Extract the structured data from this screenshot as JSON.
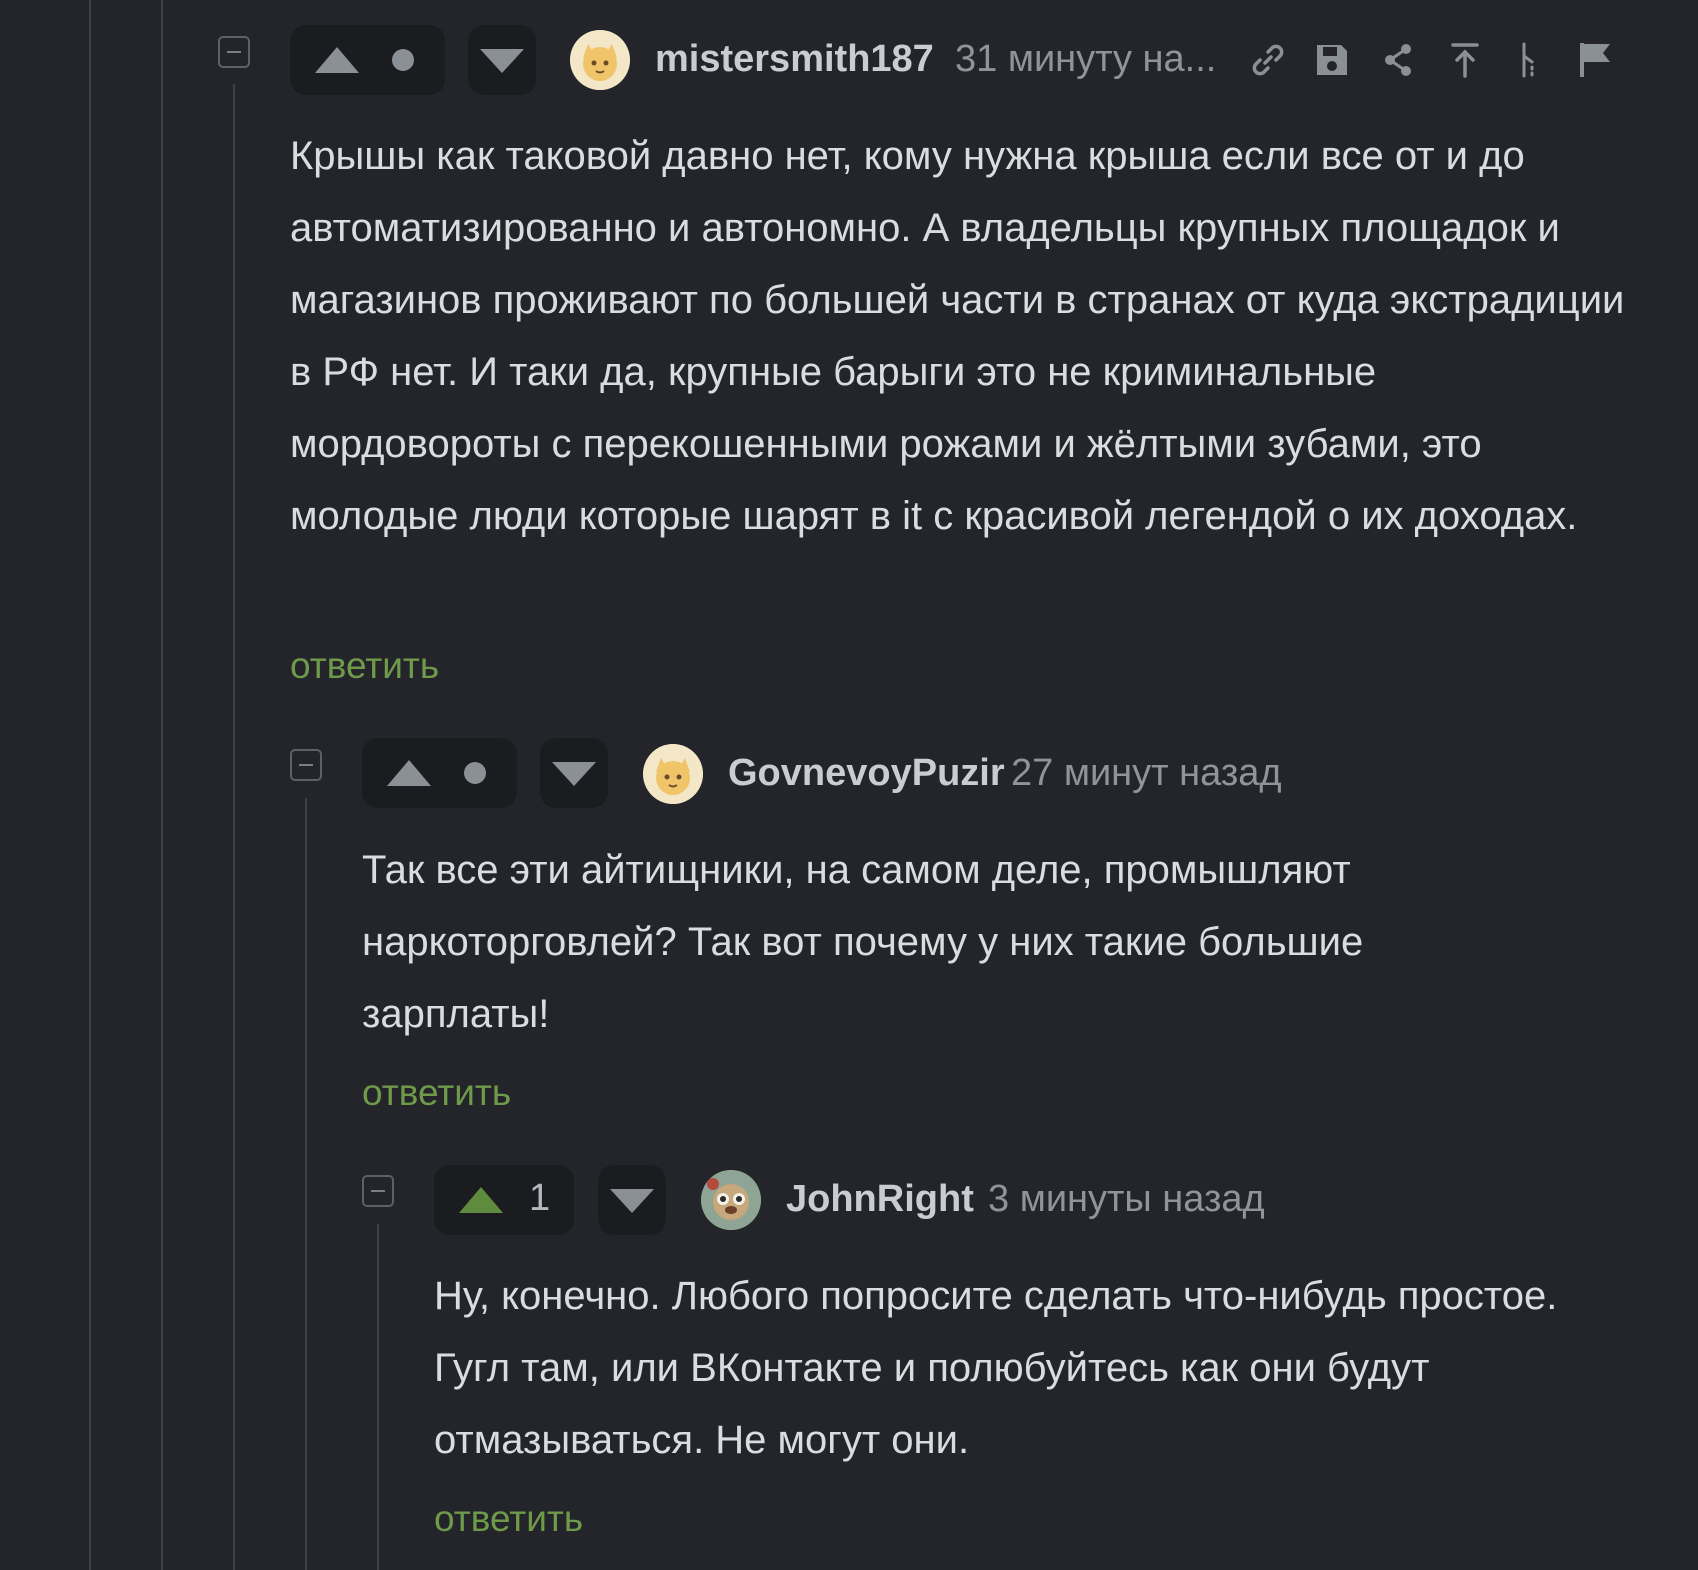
{
  "reply_label": "ответить",
  "colors": {
    "reply": "#6f9a4a",
    "upvote_active": "#5e8b3e",
    "background": "#23252a"
  },
  "comments": [
    {
      "username": "mistersmith187",
      "time": "31 минуту на...",
      "score_display": "dot",
      "avatar_icon": "avatar-cat-icon",
      "body": "Крышы как таковой давно нет, кому нужна крыша если все от и до автоматизированно и автономно. А владельцы крупных площадок и магазинов проживают по большей части в странах от куда экстрадиции в РФ нет. И таки да, крупные барыги это не криминальные мордовороты с перекошенными рожами и жёлтыми зубами, это молодые люди которые шарят в it с красивой легендой о их доходах.",
      "tools": [
        "link-icon",
        "save-icon",
        "share-icon",
        "scroll-to-top-icon",
        "branch-icon",
        "report-flag-icon"
      ]
    },
    {
      "username": "GovnevoyPuzir",
      "time": "27 минут назад",
      "score_display": "dot",
      "avatar_icon": "avatar-cat-icon",
      "body": "Так все эти айтищники, на самом деле, промышляют наркоторговлей? Так вот почему у них такие большие зарплаты!"
    },
    {
      "username": "JohnRight",
      "time": "3 минуты назад",
      "score": "1",
      "avatar_icon": "avatar-creature-icon",
      "body": "Ну, конечно. Любого попросите сделать что-нибудь простое. Гугл там, или ВКонтакте и полюбуйтесь как они будут отмазываться. Не могут они."
    }
  ]
}
